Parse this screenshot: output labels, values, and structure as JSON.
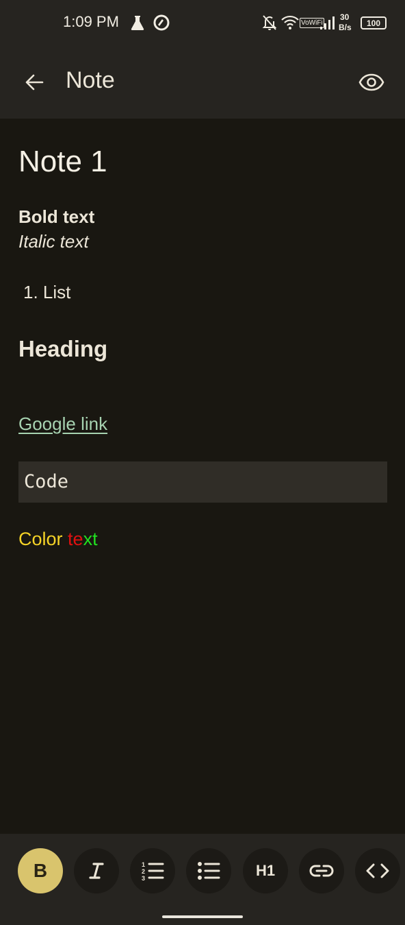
{
  "status_bar": {
    "time": "1:09 PM",
    "vowifi": "VoWiFi",
    "speed_value": "30",
    "speed_unit": "B/s",
    "battery": "100",
    "icons": [
      "flask-icon",
      "signal-app-icon",
      "bell-off-icon",
      "wifi-icon",
      "cellular-signal-icon",
      "battery-icon"
    ]
  },
  "app_bar": {
    "title": "Note",
    "back_icon": "arrow-left-icon",
    "preview_icon": "eye-icon"
  },
  "note": {
    "title": "Note 1",
    "bold": "Bold text",
    "italic": "Italic text",
    "list_item": "1. List",
    "heading": "Heading",
    "link": "Google link",
    "code": "Code",
    "color_text": {
      "part1": "Color ",
      "part2": "te",
      "part3": "xt"
    }
  },
  "toolbar": {
    "bold_label": "B",
    "heading_label": "H1",
    "items": [
      "bold-button",
      "italic-button",
      "numbered-list-button",
      "bullet-list-button",
      "heading-button",
      "link-button",
      "code-button"
    ]
  },
  "colors": {
    "background": "#191711",
    "bar": "#262420",
    "accent": "#d9c46d",
    "link": "#a7d3b1",
    "yellow": "#f5d327",
    "red": "#e01010",
    "green": "#21e021"
  }
}
